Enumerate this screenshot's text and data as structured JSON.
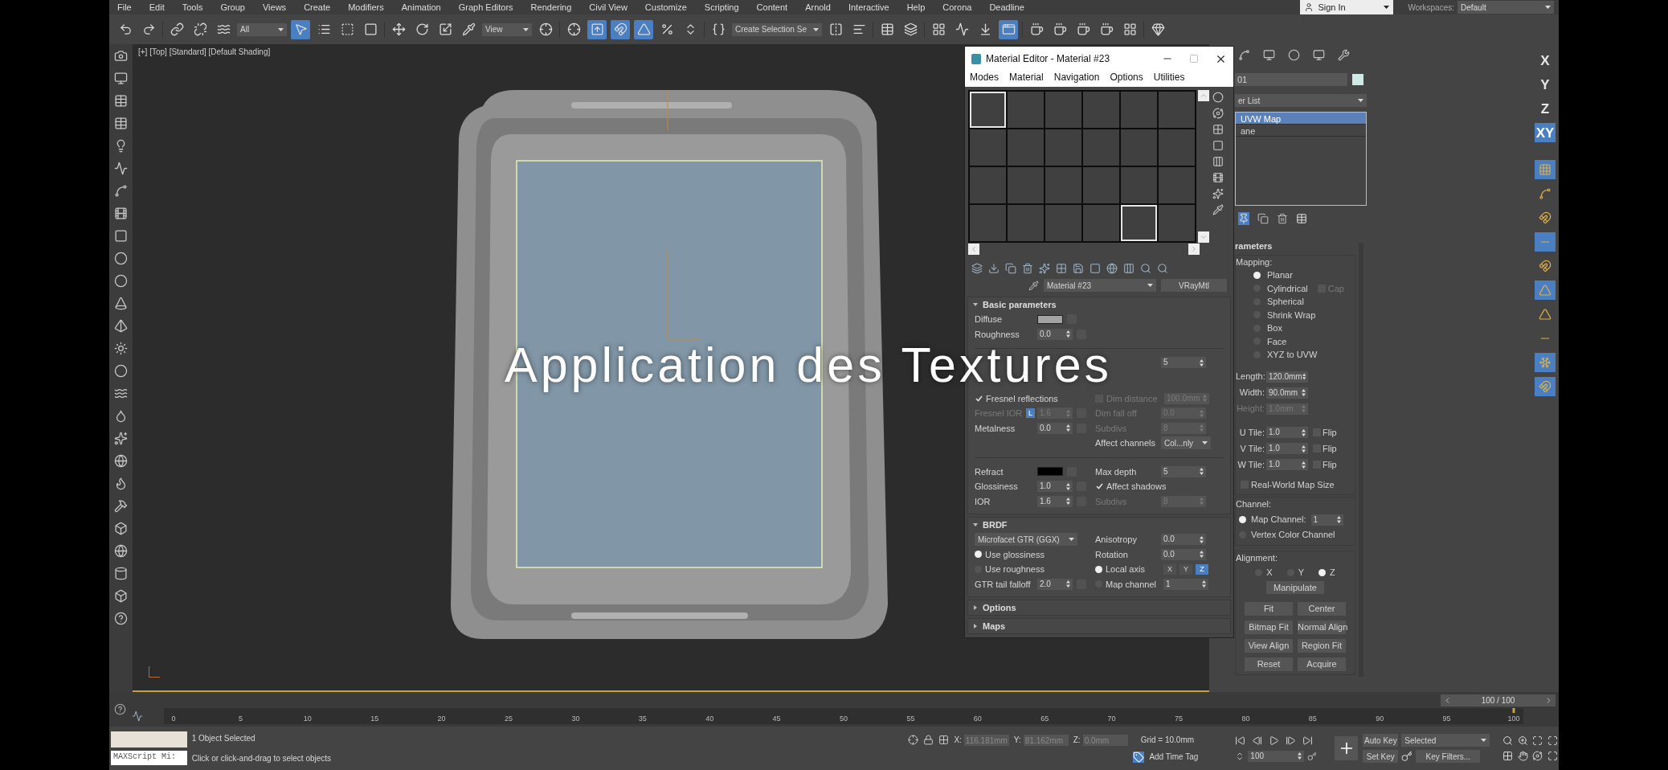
{
  "menu_bar": {
    "items": [
      "File",
      "Edit",
      "Tools",
      "Group",
      "Views",
      "Create",
      "Modifiers",
      "Animation",
      "Graph Editors",
      "Rendering",
      "Civil View",
      "Customize",
      "Scripting",
      "Content",
      "Arnold",
      "Interactive",
      "Help",
      "Corona",
      "Deadline"
    ],
    "sign_in": "Sign In",
    "workspaces_label": "Workspaces:",
    "workspace": "Default"
  },
  "main_toolbar": {
    "selection_filter": "All",
    "reference_coord": "View",
    "selection_set": "Create Selection Se",
    "tools": [
      {
        "active": false
      },
      {
        "active": false
      },
      {
        "active": false
      },
      {
        "active": false
      },
      {
        "active": false
      },
      {
        "active": true
      },
      {
        "active": false
      },
      {
        "active": false
      },
      {
        "active": false
      },
      {
        "active": false
      },
      {
        "active": false
      },
      {
        "active": false
      },
      {
        "active": false
      },
      {
        "active": false
      },
      {
        "active": false
      },
      {
        "active": true
      },
      {
        "active": true
      },
      {
        "active": true
      },
      {
        "active": false
      },
      {
        "active": false
      },
      {
        "active": false
      },
      {
        "active": false
      },
      {
        "active": false
      },
      {
        "active": false
      },
      {
        "active": false
      },
      {
        "active": false
      },
      {
        "active": false
      },
      {
        "active": false
      },
      {
        "active": true
      },
      {
        "active": false
      },
      {
        "active": false
      },
      {
        "active": false
      },
      {
        "active": false
      },
      {
        "active": false
      },
      {
        "active": false
      }
    ]
  },
  "viewport": {
    "label": "[+] [Top] [Standard] [Default Shading]",
    "overlay_title": "Application des Textures"
  },
  "material_editor": {
    "title": "Material Editor - Material #23",
    "menu": [
      "Modes",
      "Material",
      "Navigation",
      "Options",
      "Utilities"
    ],
    "slots": [
      {
        "selected": true
      },
      {
        "selected": false
      },
      {
        "selected": false
      },
      {
        "selected": false
      },
      {
        "selected": false
      },
      {
        "selected": false
      },
      {
        "selected": false
      },
      {
        "selected": false
      },
      {
        "selected": false
      },
      {
        "selected": false
      },
      {
        "selected": false
      },
      {
        "selected": false
      },
      {
        "selected": false
      },
      {
        "selected": false
      },
      {
        "selected": false
      },
      {
        "selected": false
      },
      {
        "selected": false
      },
      {
        "selected": false
      },
      {
        "selected": false
      },
      {
        "selected": false
      },
      {
        "selected": false
      },
      {
        "selected": false
      },
      {
        "selected": true
      },
      {
        "selected": false
      }
    ],
    "material_name": "Material #23",
    "material_type": "VRayMtl",
    "rollouts": [
      {
        "title": "Basic parameters",
        "expanded": true,
        "rows": [
          {
            "left": {
              "kind": "swatch",
              "label": "Diffuse",
              "color": "#a3a3a3"
            }
          },
          {
            "left": {
              "kind": "spinner",
              "label": "Roughness",
              "value": "0.0",
              "disabled": false
            }
          },
          {
            "kind": "divider"
          },
          {
            "right": {
              "kind": "spinner",
              "value": "5",
              "disabled": false
            }
          },
          {
            "kind": "spacer"
          },
          {
            "left": {
              "kind": "check",
              "label": "Fresnel reflections",
              "checked": true,
              "disabled": false
            },
            "right": {
              "kind": "check",
              "label": "Dim distance",
              "checked": false,
              "value": "100.0mm",
              "disabled": true
            }
          },
          {
            "left": {
              "kind": "spinner",
              "label": "Fresnel IOR",
              "lock": "L",
              "value": "1.6",
              "disabled": true
            },
            "right": {
              "kind": "spinner",
              "label": "Dim fall off",
              "value": "0.0",
              "disabled": true
            }
          },
          {
            "left": {
              "kind": "spinner",
              "label": "Metalness",
              "value": "0.0",
              "disabled": false
            },
            "right": {
              "kind": "spinner",
              "label": "Subdivs",
              "value": "8",
              "disabled": true
            }
          },
          {
            "right": {
              "kind": "dropdown",
              "label": "Affect channels",
              "value": "Col...nly"
            }
          },
          {
            "kind": "divider"
          },
          {
            "left": {
              "kind": "swatch",
              "label": "Refract",
              "color": "#000000"
            },
            "right": {
              "kind": "spinner",
              "label": "Max depth",
              "value": "5",
              "disabled": false
            }
          },
          {
            "left": {
              "kind": "spinner",
              "label": "Glossiness",
              "value": "1.0",
              "disabled": false
            },
            "right": {
              "kind": "check",
              "label": "Affect shadows",
              "checked": true,
              "disabled": false
            }
          },
          {
            "left": {
              "kind": "spinner",
              "label": "IOR",
              "value": "1.6",
              "disabled": false
            },
            "right": {
              "kind": "spinner",
              "label": "Subdivs",
              "value": "8",
              "disabled": true
            }
          }
        ]
      },
      {
        "title": "BRDF",
        "expanded": true,
        "rows": [
          {
            "left": {
              "kind": "dropdown",
              "value": "Microfacet GTR (GGX)"
            },
            "right": {
              "kind": "spinner",
              "label": "Anisotropy",
              "value": "0.0",
              "disabled": false
            }
          },
          {
            "left": {
              "kind": "radio",
              "label": "Use glossiness",
              "selected": true
            },
            "right": {
              "kind": "spinner",
              "label": "Rotation",
              "value": "0.0",
              "disabled": false
            }
          },
          {
            "left": {
              "kind": "radio",
              "label": "Use roughness",
              "selected": false
            },
            "right": {
              "kind": "radio",
              "label": "Local axis",
              "selected": true,
              "axes": [
                {
                  "label": "X",
                  "selected": false
                },
                {
                  "label": "Y",
                  "selected": false
                },
                {
                  "label": "Z",
                  "selected": true
                }
              ]
            }
          },
          {
            "left": {
              "kind": "spinner",
              "label": "GTR tail falloff",
              "value": "2.0",
              "disabled": false
            },
            "right": {
              "kind": "radio",
              "label": "Map channel",
              "selected": false,
              "value": "1"
            }
          }
        ]
      },
      {
        "title": "Options",
        "expanded": false
      },
      {
        "title": "Maps",
        "expanded": false
      }
    ]
  },
  "command_panel": {
    "object_name": "01",
    "modifier_list": "er List",
    "stack": [
      {
        "label": "UVW Map",
        "selected": true
      },
      {
        "label": "ane",
        "selected": false
      }
    ],
    "rollout_title": "rameters",
    "mapping_label": "Mapping:",
    "mapping": [
      {
        "label": "Planar",
        "selected": true
      },
      {
        "label": "Cylindrical",
        "selected": false
      },
      {
        "label": "Spherical",
        "selected": false
      },
      {
        "label": "Shrink Wrap",
        "selected": false
      },
      {
        "label": "Box",
        "selected": false
      },
      {
        "label": "Face",
        "selected": false
      },
      {
        "label": "XYZ to UVW",
        "selected": false
      }
    ],
    "cap": {
      "label": "Cap",
      "checked": false
    },
    "dims": [
      {
        "label": "Length:",
        "value": "120.0mm",
        "disabled": false
      },
      {
        "label": "Width:",
        "value": "90.0mm",
        "disabled": false
      },
      {
        "label": "Height:",
        "value": "1.0mm",
        "disabled": true
      }
    ],
    "tiles": [
      {
        "label": "U Tile:",
        "value": "1.0",
        "flip": "Flip",
        "checked": false
      },
      {
        "label": "V Tile:",
        "value": "1.0",
        "flip": "Flip",
        "checked": false
      },
      {
        "label": "W Tile:",
        "value": "1.0",
        "flip": "Flip",
        "checked": false
      }
    ],
    "real_world": {
      "label": "Real-World Map Size",
      "checked": false
    },
    "channel_label": "Channel:",
    "channels": [
      {
        "label": "Map Channel:",
        "selected": true,
        "value": "1"
      },
      {
        "label": "Vertex Color Channel",
        "selected": false
      }
    ],
    "alignment_label": "Alignment:",
    "axes": [
      {
        "label": "X",
        "selected": false
      },
      {
        "label": "Y",
        "selected": false
      },
      {
        "label": "Z",
        "selected": true
      }
    ],
    "manipulate": "Manipulate",
    "buttons": [
      "Fit",
      "Center",
      "Bitmap Fit",
      "Normal Align",
      "View Align",
      "Region Fit",
      "Reset",
      "Acquire"
    ]
  },
  "axis_toolbar": {
    "axes": [
      {
        "label": "X",
        "active": false
      },
      {
        "label": "Y",
        "active": false
      },
      {
        "label": "Z",
        "active": false
      },
      {
        "label": "XY",
        "active": true
      }
    ],
    "tools": [
      {
        "active": true
      },
      {
        "active": false
      },
      {
        "active": false
      },
      {
        "active": true
      },
      {
        "active": false
      },
      {
        "active": true
      },
      {
        "active": false
      },
      {
        "active": false
      },
      {
        "active": true
      },
      {
        "active": true
      }
    ]
  },
  "timeline": {
    "slider": {
      "label": "100 / 100",
      "level": 1
    },
    "ticks": [
      "0",
      "5",
      "10",
      "15",
      "20",
      "25",
      "30",
      "35",
      "40",
      "45",
      "50",
      "55",
      "60",
      "65",
      "70",
      "75",
      "80",
      "85",
      "90",
      "95",
      "100"
    ]
  },
  "status_bar": {
    "listener": "MAXScript Mi:",
    "selection": "1 Object Selected",
    "prompt": "Click or click-and-drag to select objects",
    "coords": [
      {
        "label": "X:",
        "value": "116.181mm"
      },
      {
        "label": "Y:",
        "value": "81.162mm"
      },
      {
        "label": "Z:",
        "value": "0.0mm"
      }
    ],
    "grid": "Grid = 10.0mm",
    "add_time_tag": "Add Time Tag",
    "frame": "100",
    "auto_key": "Auto Key",
    "key_mode": "Selected",
    "set_key": "Set Key",
    "key_filters": "Key Filters..."
  }
}
